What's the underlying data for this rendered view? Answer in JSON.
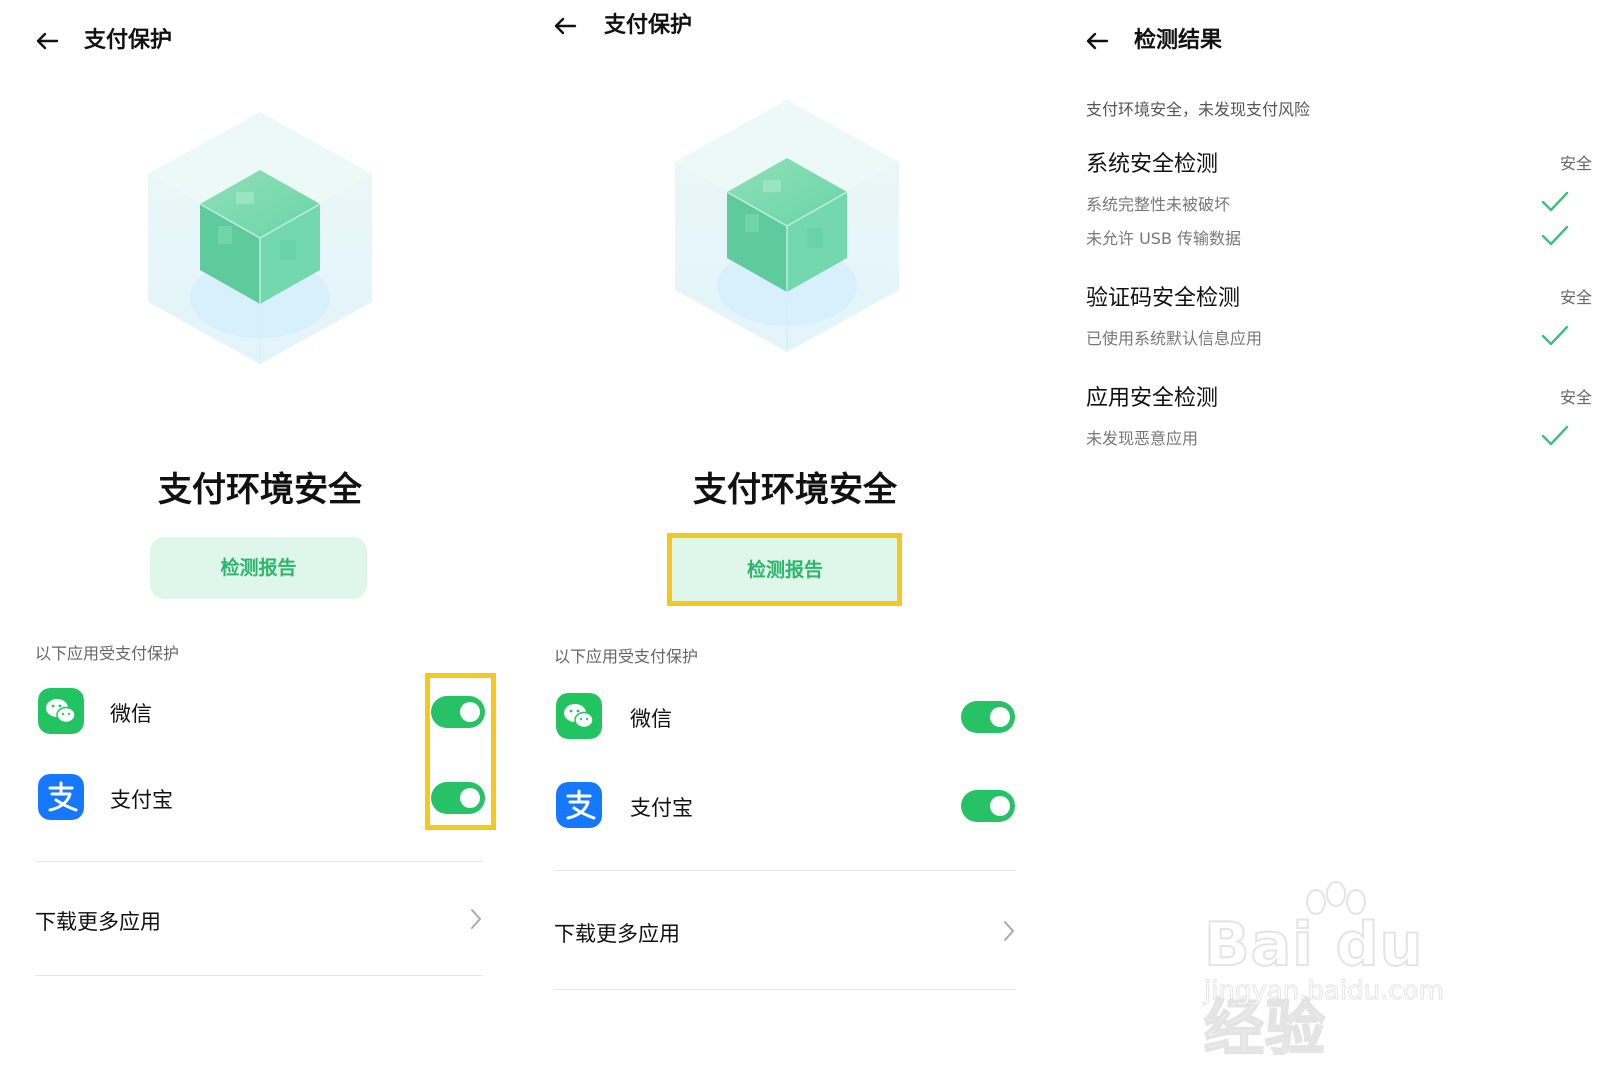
{
  "colors": {
    "accent": "#2cb66c",
    "toggle_on": "#28c266",
    "highlight": "#f6c71e",
    "button_bg": "#dff6ea"
  },
  "panel1": {
    "header": {
      "title": "支付保护",
      "back_icon": "arrow-left-icon"
    },
    "status_title": "支付环境安全",
    "report_button": "检测报告",
    "section_label": "以下应用受支付保护",
    "apps": [
      {
        "name": "微信",
        "icon": "wechat-icon",
        "enabled": true
      },
      {
        "name": "支付宝",
        "icon": "alipay-icon",
        "enabled": true
      }
    ],
    "more": {
      "label": "下载更多应用",
      "icon": "chevron-right-icon"
    }
  },
  "panel2": {
    "header": {
      "title": "支付保护",
      "back_icon": "arrow-left-icon"
    },
    "status_title": "支付环境安全",
    "report_button": "检测报告",
    "section_label": "以下应用受支付保护",
    "apps": [
      {
        "name": "微信",
        "icon": "wechat-icon",
        "enabled": true
      },
      {
        "name": "支付宝",
        "icon": "alipay-icon",
        "enabled": true
      }
    ],
    "more": {
      "label": "下载更多应用",
      "icon": "chevron-right-icon"
    }
  },
  "panel3": {
    "header": {
      "title": "检测结果",
      "back_icon": "arrow-left-icon"
    },
    "summary": "支付环境安全，未发现支付风险",
    "categories": [
      {
        "name": "系统安全检测",
        "status": "安全",
        "items": [
          "系统完整性未被破坏",
          "未允许 USB 传输数据"
        ]
      },
      {
        "name": "验证码安全检测",
        "status": "安全",
        "items": [
          "已使用系统默认信息应用"
        ]
      },
      {
        "name": "应用安全检测",
        "status": "安全",
        "items": [
          "未发现恶意应用"
        ]
      }
    ]
  },
  "watermark": {
    "main": "Bai du 经验",
    "sub": "jingyan.baidu.com"
  }
}
